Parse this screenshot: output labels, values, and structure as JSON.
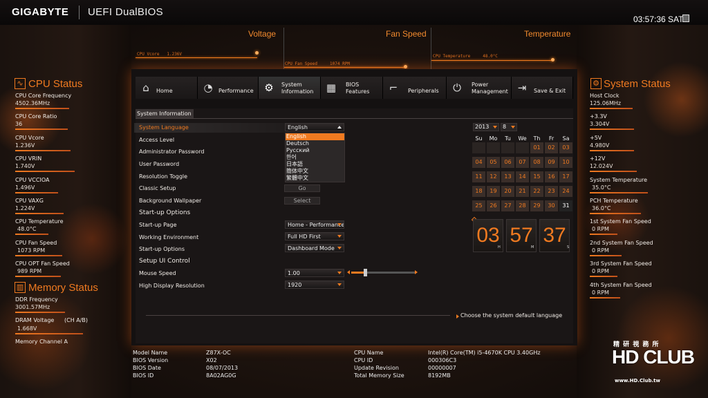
{
  "header": {
    "brand": "GIGABYTE",
    "product": "UEFI DualBIOS",
    "clock": "03:57:36 SAT"
  },
  "monitor": {
    "voltage": {
      "title": "Voltage",
      "label": "CPU Vcore",
      "value": "1.236V"
    },
    "fan": {
      "title": "Fan Speed",
      "label": "CPU Fan Speed",
      "value": "1074 RPM"
    },
    "temperature": {
      "title": "Temperature",
      "label": "CPU Temperature",
      "value": "48.0°C"
    }
  },
  "cpu_status": {
    "title": "CPU Status",
    "items": [
      {
        "label": "CPU Core Frequency",
        "value": "4502.36MHz"
      },
      {
        "label": "CPU Core Ratio",
        "value": "36"
      },
      {
        "label": "CPU Vcore",
        "value": "1.236V"
      },
      {
        "label": "CPU VRIN",
        "value": "1.740V"
      },
      {
        "label": "CPU VCCIOA",
        "value": "1.496V"
      },
      {
        "label": "CPU VAXG",
        "value": "1.224V"
      },
      {
        "label": "CPU Temperature",
        "value": "48.0°C"
      },
      {
        "label": "CPU Fan Speed",
        "value": "1073 RPM"
      },
      {
        "label": "CPU OPT Fan Speed",
        "value": "989 RPM"
      }
    ]
  },
  "memory_status": {
    "title": "Memory Status",
    "items": [
      {
        "label": "DDR Frequency",
        "value": "3001.57MHz"
      },
      {
        "label": "DRAM Voltage",
        "extra": "(CH A/B)",
        "value": "1.668V"
      },
      {
        "label": "Memory Channel A",
        "value": ""
      }
    ]
  },
  "system_status": {
    "title": "System Status",
    "items": [
      {
        "label": "Host Clock",
        "value": "125.06MHz"
      },
      {
        "label": "+3.3V",
        "value": "3.304V"
      },
      {
        "label": "+5V",
        "value": "4.980V"
      },
      {
        "label": "+12V",
        "value": "12.024V"
      },
      {
        "label": "System Temperature",
        "value": "35.0°C"
      },
      {
        "label": "PCH Temperature",
        "value": "36.0°C"
      },
      {
        "label": "1st System Fan Speed",
        "value": "0 RPM"
      },
      {
        "label": "2nd System Fan Speed",
        "value": "0 RPM"
      },
      {
        "label": "3rd System Fan Speed",
        "value": "0 RPM"
      },
      {
        "label": "4th System Fan Speed",
        "value": "0 RPM"
      }
    ]
  },
  "tabs": {
    "home": "Home",
    "performance": "Performance",
    "system_information": [
      "System",
      "Information"
    ],
    "bios_features": [
      "BIOS",
      "Features"
    ],
    "peripherals": "Peripherals",
    "power_management": [
      "Power",
      "Management"
    ],
    "save_exit": "Save & Exit"
  },
  "subtab": "System Information",
  "options": {
    "system_language": "System Language",
    "access_level": "Access Level",
    "admin_password": "Administrator Password",
    "user_password": "User Password",
    "resolution_toggle": "Resolution Toggle",
    "classic_setup": "Classic Setup",
    "background_wallpaper": "Background Wallpaper",
    "startup_options_head": "Start-up Options",
    "startup_page": "Start-up Page",
    "working_environment": "Working Environment",
    "startup_options": "Start-up Options",
    "setup_ui_head": "Setup UI Control",
    "mouse_speed": "Mouse Speed",
    "high_display_resolution": "High Display Resolution"
  },
  "values": {
    "system_language": "English",
    "classic_setup_btn": "Go",
    "wallpaper_btn": "Select",
    "startup_page": "Home - Performance",
    "working_environment": "Full HD First",
    "startup_options": "Dashboard Mode",
    "mouse_speed": "1.00",
    "high_display_resolution": "1920"
  },
  "languages": [
    "English",
    "Deutsch",
    "Русский",
    "한어",
    "日本語",
    "簡体中文",
    "繁體中文"
  ],
  "selected_language": "English",
  "help_text": "Choose the system default language",
  "calendar": {
    "year": "2013",
    "month": "8",
    "days_header": [
      "Su",
      "Mo",
      "Tu",
      "We",
      "Th",
      "Fr",
      "Sa"
    ],
    "weeks": [
      [
        "",
        "",
        "",
        "",
        "01",
        "02",
        "03"
      ],
      [
        "04",
        "05",
        "06",
        "07",
        "08",
        "09",
        "10"
      ],
      [
        "11",
        "12",
        "13",
        "14",
        "15",
        "16",
        "17"
      ],
      [
        "18",
        "19",
        "20",
        "21",
        "22",
        "23",
        "24"
      ],
      [
        "25",
        "26",
        "27",
        "28",
        "29",
        "30",
        "31"
      ]
    ],
    "today": "31"
  },
  "clock": {
    "hours": "03",
    "minutes": "57",
    "seconds": "37",
    "h_unit": "H",
    "m_unit": "M",
    "s_unit": "S"
  },
  "info_left": {
    "labels": [
      "Model Name",
      "BIOS Version",
      "BIOS Date",
      "BIOS ID"
    ],
    "values": [
      "Z87X-OC",
      "X02",
      "08/07/2013",
      "8A02AG0G"
    ]
  },
  "info_right": {
    "labels": [
      "CPU Name",
      "CPU ID",
      "Update Revision",
      "Total Memory Size"
    ],
    "values": [
      "Intel(R) Core(TM) i5-4670K CPU 3.40GHz",
      "000306C3",
      "00000007",
      "8192MB"
    ]
  },
  "watermark": {
    "chinese": "精 研 視 務 所",
    "brand": "HD CLUB",
    "url": "www.HD.Club.tw"
  },
  "colors": {
    "accent": "#f07a20",
    "background": "#141111"
  }
}
